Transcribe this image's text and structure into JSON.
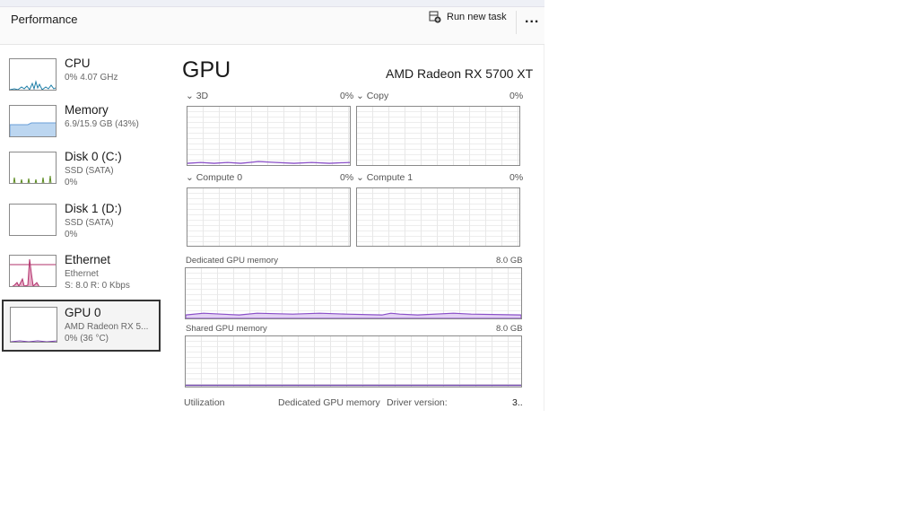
{
  "header": {
    "title": "Performance",
    "run_new_task": "Run new task",
    "more": "..."
  },
  "sidebar": {
    "items": [
      {
        "name": "CPU",
        "sub1": "0% 4.07 GHz",
        "color": "#1f7fa8"
      },
      {
        "name": "Memory",
        "sub1": "6.9/15.9 GB (43%)",
        "color": "#6a9fd8"
      },
      {
        "name": "Disk 0 (C:)",
        "sub1": "SSD (SATA)",
        "sub2": "0%",
        "color": "#5a8a1f"
      },
      {
        "name": "Disk 1 (D:)",
        "sub1": "SSD (SATA)",
        "sub2": "0%",
        "color": "#5a8a1f"
      },
      {
        "name": "Ethernet",
        "sub1": "Ethernet",
        "sub2": "S: 8.0 R: 0 Kbps",
        "color": "#b0306a"
      },
      {
        "name": "GPU 0",
        "sub1": "AMD Radeon RX 5...",
        "sub2": "0%  (36 °C)",
        "color": "#7a3fb0"
      }
    ]
  },
  "main": {
    "title": "GPU",
    "model": "AMD Radeon RX 5700 XT",
    "engines": [
      {
        "label": "3D",
        "value": "0%"
      },
      {
        "label": "Copy",
        "value": "0%"
      },
      {
        "label": "Compute 0",
        "value": "0%"
      },
      {
        "label": "Compute 1",
        "value": "0%"
      }
    ],
    "dedicated": {
      "label": "Dedicated GPU memory",
      "max": "8.0 GB"
    },
    "shared": {
      "label": "Shared GPU memory",
      "max": "8.0 GB"
    },
    "footer": {
      "utilization": "Utilization",
      "dedicated": "Dedicated GPU memory",
      "driver": "Driver version:",
      "driver_value": "3.."
    }
  }
}
